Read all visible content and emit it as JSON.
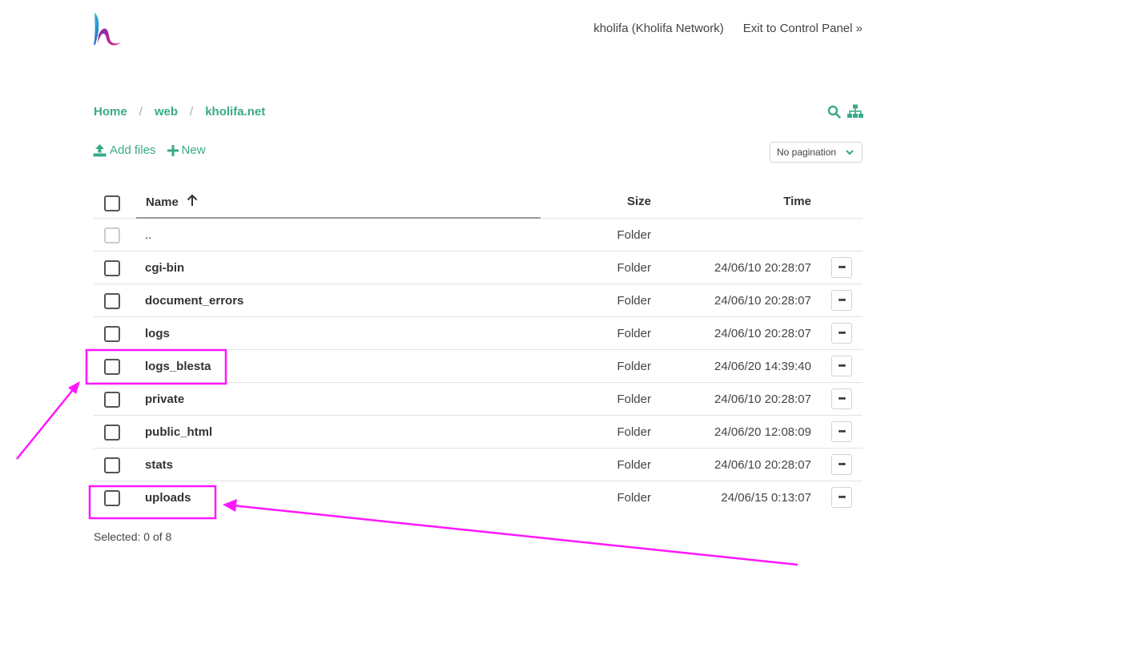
{
  "header": {
    "user_label": "kholifa (Kholifa Network)",
    "exit_label": "Exit to Control Panel »"
  },
  "breadcrumb": [
    "Home",
    "web",
    "kholifa.net"
  ],
  "toolbar": {
    "add_files_label": "Add files",
    "new_label": "New",
    "pagination_label": "No pagination"
  },
  "table": {
    "columns": {
      "name": "Name",
      "size": "Size",
      "time": "Time"
    },
    "rows": [
      {
        "name": "..",
        "size": "Folder",
        "time": ""
      },
      {
        "name": "cgi-bin",
        "size": "Folder",
        "time": "24/06/10 20:28:07"
      },
      {
        "name": "document_errors",
        "size": "Folder",
        "time": "24/06/10 20:28:07"
      },
      {
        "name": "logs",
        "size": "Folder",
        "time": "24/06/10 20:28:07"
      },
      {
        "name": "logs_blesta",
        "size": "Folder",
        "time": "24/06/20 14:39:40"
      },
      {
        "name": "private",
        "size": "Folder",
        "time": "24/06/10 20:28:07"
      },
      {
        "name": "public_html",
        "size": "Folder",
        "time": "24/06/20 12:08:09"
      },
      {
        "name": "stats",
        "size": "Folder",
        "time": "24/06/10 20:28:07"
      },
      {
        "name": "uploads",
        "size": "Folder",
        "time": "24/06/15 0:13:07"
      }
    ]
  },
  "footer": {
    "selected_label": "Selected: 0 of 8"
  },
  "colors": {
    "accent": "#3aa98a",
    "annotation": "#ff17ff"
  }
}
